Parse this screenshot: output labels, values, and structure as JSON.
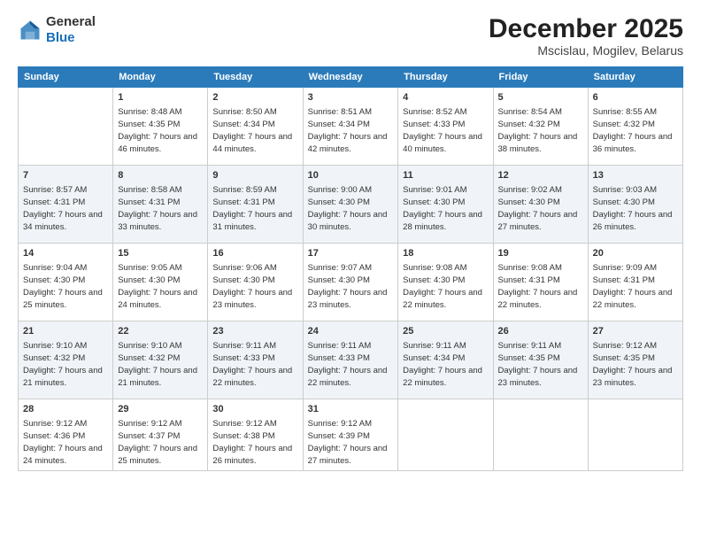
{
  "header": {
    "logo_general": "General",
    "logo_blue": "Blue",
    "month_title": "December 2025",
    "subtitle": "Mscislau, Mogilev, Belarus"
  },
  "days_of_week": [
    "Sunday",
    "Monday",
    "Tuesday",
    "Wednesday",
    "Thursday",
    "Friday",
    "Saturday"
  ],
  "weeks": [
    [
      {
        "day": "",
        "sunrise": "",
        "sunset": "",
        "daylight": ""
      },
      {
        "day": "1",
        "sunrise": "Sunrise: 8:48 AM",
        "sunset": "Sunset: 4:35 PM",
        "daylight": "Daylight: 7 hours and 46 minutes."
      },
      {
        "day": "2",
        "sunrise": "Sunrise: 8:50 AM",
        "sunset": "Sunset: 4:34 PM",
        "daylight": "Daylight: 7 hours and 44 minutes."
      },
      {
        "day": "3",
        "sunrise": "Sunrise: 8:51 AM",
        "sunset": "Sunset: 4:34 PM",
        "daylight": "Daylight: 7 hours and 42 minutes."
      },
      {
        "day": "4",
        "sunrise": "Sunrise: 8:52 AM",
        "sunset": "Sunset: 4:33 PM",
        "daylight": "Daylight: 7 hours and 40 minutes."
      },
      {
        "day": "5",
        "sunrise": "Sunrise: 8:54 AM",
        "sunset": "Sunset: 4:32 PM",
        "daylight": "Daylight: 7 hours and 38 minutes."
      },
      {
        "day": "6",
        "sunrise": "Sunrise: 8:55 AM",
        "sunset": "Sunset: 4:32 PM",
        "daylight": "Daylight: 7 hours and 36 minutes."
      }
    ],
    [
      {
        "day": "7",
        "sunrise": "Sunrise: 8:57 AM",
        "sunset": "Sunset: 4:31 PM",
        "daylight": "Daylight: 7 hours and 34 minutes."
      },
      {
        "day": "8",
        "sunrise": "Sunrise: 8:58 AM",
        "sunset": "Sunset: 4:31 PM",
        "daylight": "Daylight: 7 hours and 33 minutes."
      },
      {
        "day": "9",
        "sunrise": "Sunrise: 8:59 AM",
        "sunset": "Sunset: 4:31 PM",
        "daylight": "Daylight: 7 hours and 31 minutes."
      },
      {
        "day": "10",
        "sunrise": "Sunrise: 9:00 AM",
        "sunset": "Sunset: 4:30 PM",
        "daylight": "Daylight: 7 hours and 30 minutes."
      },
      {
        "day": "11",
        "sunrise": "Sunrise: 9:01 AM",
        "sunset": "Sunset: 4:30 PM",
        "daylight": "Daylight: 7 hours and 28 minutes."
      },
      {
        "day": "12",
        "sunrise": "Sunrise: 9:02 AM",
        "sunset": "Sunset: 4:30 PM",
        "daylight": "Daylight: 7 hours and 27 minutes."
      },
      {
        "day": "13",
        "sunrise": "Sunrise: 9:03 AM",
        "sunset": "Sunset: 4:30 PM",
        "daylight": "Daylight: 7 hours and 26 minutes."
      }
    ],
    [
      {
        "day": "14",
        "sunrise": "Sunrise: 9:04 AM",
        "sunset": "Sunset: 4:30 PM",
        "daylight": "Daylight: 7 hours and 25 minutes."
      },
      {
        "day": "15",
        "sunrise": "Sunrise: 9:05 AM",
        "sunset": "Sunset: 4:30 PM",
        "daylight": "Daylight: 7 hours and 24 minutes."
      },
      {
        "day": "16",
        "sunrise": "Sunrise: 9:06 AM",
        "sunset": "Sunset: 4:30 PM",
        "daylight": "Daylight: 7 hours and 23 minutes."
      },
      {
        "day": "17",
        "sunrise": "Sunrise: 9:07 AM",
        "sunset": "Sunset: 4:30 PM",
        "daylight": "Daylight: 7 hours and 23 minutes."
      },
      {
        "day": "18",
        "sunrise": "Sunrise: 9:08 AM",
        "sunset": "Sunset: 4:30 PM",
        "daylight": "Daylight: 7 hours and 22 minutes."
      },
      {
        "day": "19",
        "sunrise": "Sunrise: 9:08 AM",
        "sunset": "Sunset: 4:31 PM",
        "daylight": "Daylight: 7 hours and 22 minutes."
      },
      {
        "day": "20",
        "sunrise": "Sunrise: 9:09 AM",
        "sunset": "Sunset: 4:31 PM",
        "daylight": "Daylight: 7 hours and 22 minutes."
      }
    ],
    [
      {
        "day": "21",
        "sunrise": "Sunrise: 9:10 AM",
        "sunset": "Sunset: 4:32 PM",
        "daylight": "Daylight: 7 hours and 21 minutes."
      },
      {
        "day": "22",
        "sunrise": "Sunrise: 9:10 AM",
        "sunset": "Sunset: 4:32 PM",
        "daylight": "Daylight: 7 hours and 21 minutes."
      },
      {
        "day": "23",
        "sunrise": "Sunrise: 9:11 AM",
        "sunset": "Sunset: 4:33 PM",
        "daylight": "Daylight: 7 hours and 22 minutes."
      },
      {
        "day": "24",
        "sunrise": "Sunrise: 9:11 AM",
        "sunset": "Sunset: 4:33 PM",
        "daylight": "Daylight: 7 hours and 22 minutes."
      },
      {
        "day": "25",
        "sunrise": "Sunrise: 9:11 AM",
        "sunset": "Sunset: 4:34 PM",
        "daylight": "Daylight: 7 hours and 22 minutes."
      },
      {
        "day": "26",
        "sunrise": "Sunrise: 9:11 AM",
        "sunset": "Sunset: 4:35 PM",
        "daylight": "Daylight: 7 hours and 23 minutes."
      },
      {
        "day": "27",
        "sunrise": "Sunrise: 9:12 AM",
        "sunset": "Sunset: 4:35 PM",
        "daylight": "Daylight: 7 hours and 23 minutes."
      }
    ],
    [
      {
        "day": "28",
        "sunrise": "Sunrise: 9:12 AM",
        "sunset": "Sunset: 4:36 PM",
        "daylight": "Daylight: 7 hours and 24 minutes."
      },
      {
        "day": "29",
        "sunrise": "Sunrise: 9:12 AM",
        "sunset": "Sunset: 4:37 PM",
        "daylight": "Daylight: 7 hours and 25 minutes."
      },
      {
        "day": "30",
        "sunrise": "Sunrise: 9:12 AM",
        "sunset": "Sunset: 4:38 PM",
        "daylight": "Daylight: 7 hours and 26 minutes."
      },
      {
        "day": "31",
        "sunrise": "Sunrise: 9:12 AM",
        "sunset": "Sunset: 4:39 PM",
        "daylight": "Daylight: 7 hours and 27 minutes."
      },
      {
        "day": "",
        "sunrise": "",
        "sunset": "",
        "daylight": ""
      },
      {
        "day": "",
        "sunrise": "",
        "sunset": "",
        "daylight": ""
      },
      {
        "day": "",
        "sunrise": "",
        "sunset": "",
        "daylight": ""
      }
    ]
  ]
}
